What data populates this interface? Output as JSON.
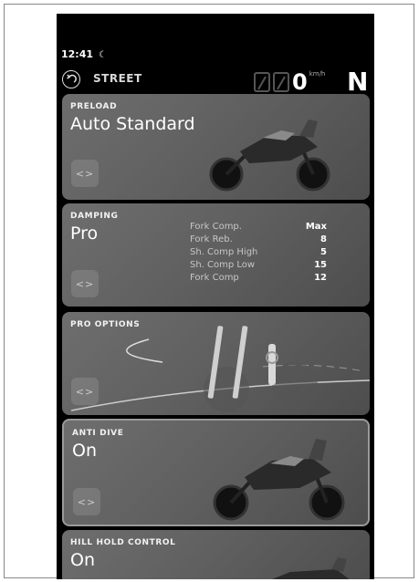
{
  "status": {
    "time": "12:41",
    "night_icon": "moon-icon"
  },
  "header": {
    "mode": "STREET",
    "speed": "0",
    "speed_unit": "km/h",
    "gear": "N"
  },
  "cards": [
    {
      "title": "PRELOAD",
      "value": "Auto Standard",
      "cycle": "<>"
    },
    {
      "title": "DAMPING",
      "value": "Pro",
      "cycle": "<>",
      "params": [
        {
          "label": "Fork Comp.",
          "value": "Max"
        },
        {
          "label": "Fork Reb.",
          "value": "8"
        },
        {
          "label": "Sh. Comp High",
          "value": "5"
        },
        {
          "label": "Sh. Comp Low",
          "value": "15"
        },
        {
          "label": "Fork Comp",
          "value": "12"
        }
      ]
    },
    {
      "title": "PRO OPTIONS",
      "cycle": "<>"
    },
    {
      "title": "ANTI DIVE",
      "value": "On",
      "cycle": "<>"
    },
    {
      "title": "HILL HOLD CONTROL",
      "value": "On"
    }
  ]
}
